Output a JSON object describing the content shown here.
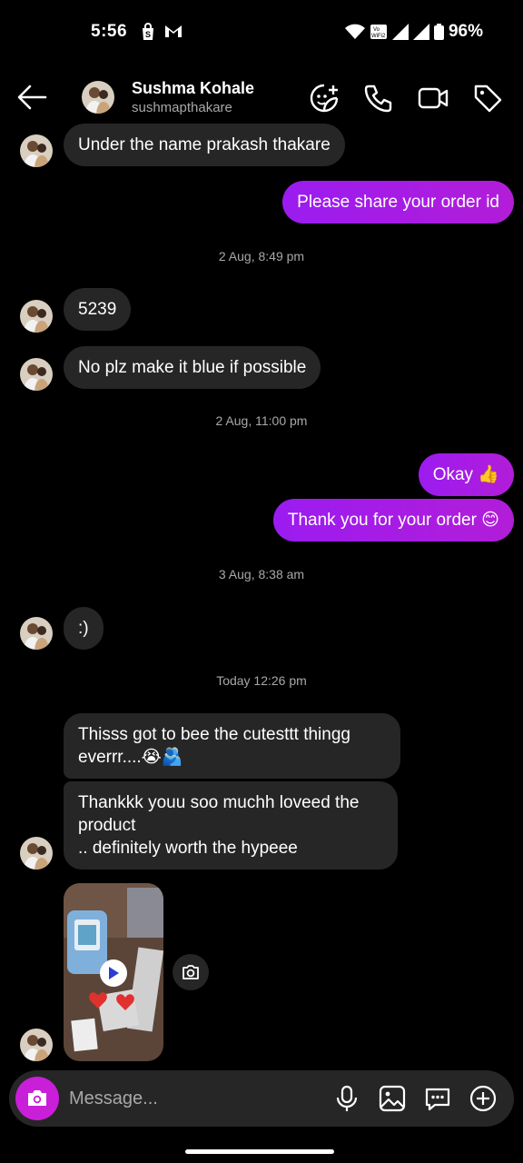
{
  "status_bar": {
    "time": "5:56",
    "battery": "96%",
    "network_badge": "Vo\nWiFi2"
  },
  "header": {
    "name": "Sushma Kohale",
    "username": "sushmapthakare"
  },
  "messages": [
    {
      "dir": "in",
      "text": "Under the name prakash thakare"
    },
    {
      "dir": "out",
      "text": "Please share your order id"
    },
    {
      "dir": "ts",
      "text": "2 Aug, 8:49 pm"
    },
    {
      "dir": "in",
      "text": "5239"
    },
    {
      "dir": "in",
      "text": "No plz make it blue if possible"
    },
    {
      "dir": "ts",
      "text": "2 Aug, 11:00 pm"
    },
    {
      "dir": "out",
      "text": "Okay 👍"
    },
    {
      "dir": "out",
      "text": "Thank you for your order 😊"
    },
    {
      "dir": "ts",
      "text": "3 Aug, 8:38 am"
    },
    {
      "dir": "in",
      "text": ":)"
    },
    {
      "dir": "ts",
      "text": "Today 12:26 pm"
    },
    {
      "dir": "in",
      "lines": [
        "Thisss got to bee the cutesttt thingg",
        "everrr....😭🫂"
      ]
    },
    {
      "dir": "in",
      "lines": [
        "Thankkk youu soo muchh loveed the",
        "product",
        ".. definitely worth the hypeee"
      ]
    }
  ],
  "composer": {
    "placeholder": "Message..."
  },
  "icons": {
    "back": "arrow-left-icon",
    "call": "phone-icon",
    "video": "video-camera-icon",
    "tag": "tag-icon",
    "sticker": "sticker-add-icon",
    "mic": "microphone-icon",
    "gallery": "gallery-icon",
    "chat": "chat-bubble-icon",
    "add": "plus-circle-icon",
    "camera": "camera-icon",
    "play": "play-icon"
  },
  "colors": {
    "background": "#000000",
    "incoming_bubble": "#262626",
    "outgoing_bubble": "#a11fe0",
    "camera_button": "#c91fd8"
  }
}
